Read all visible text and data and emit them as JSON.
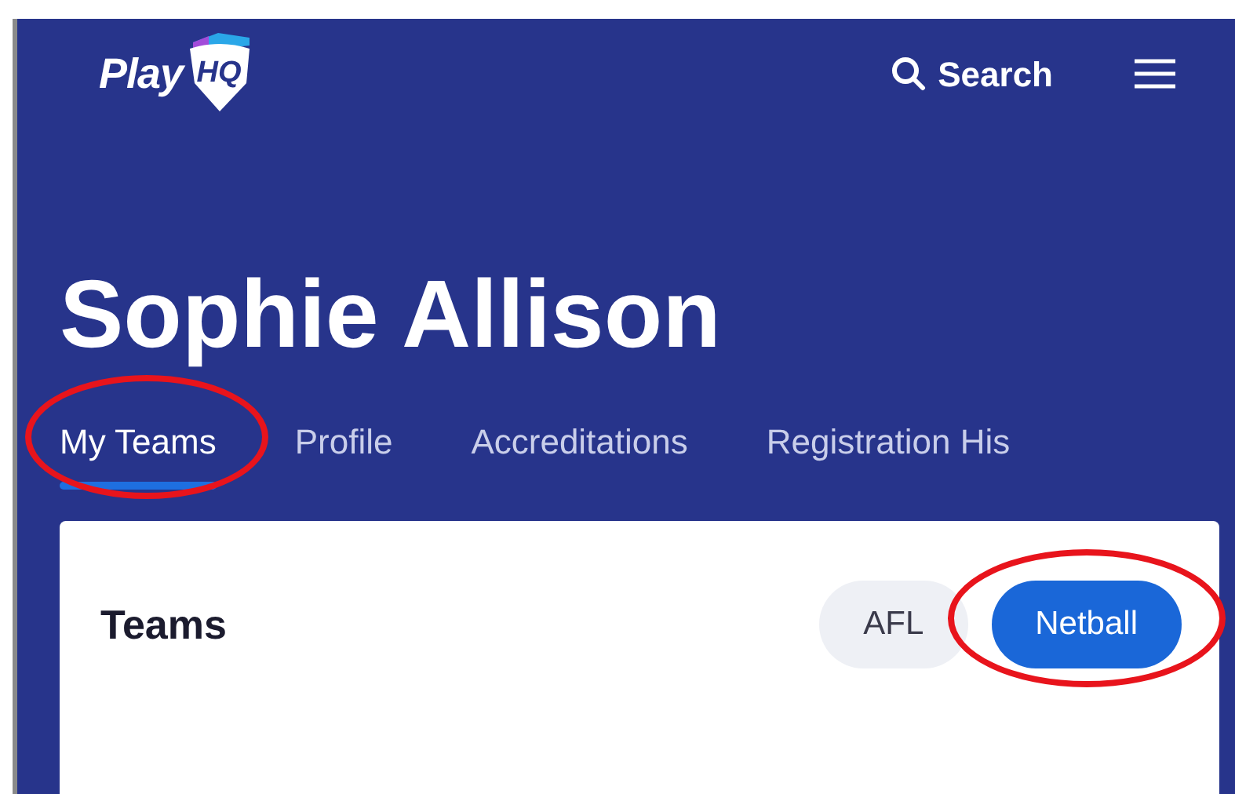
{
  "header": {
    "logo": {
      "text": "Play",
      "mark": "HQ"
    },
    "search": "Search"
  },
  "title": "Sophie Allison",
  "tabs": [
    {
      "label": "My Teams",
      "selected": true,
      "circled": true
    },
    {
      "label": "Profile",
      "selected": false,
      "circled": false
    },
    {
      "label": "Accreditations",
      "selected": false,
      "circled": false
    },
    {
      "label": "Registration His",
      "selected": false,
      "circled": false
    }
  ],
  "card": {
    "title": "Teams",
    "filters": [
      {
        "label": "AFL",
        "selected": false,
        "circled": false
      },
      {
        "label": "Netball",
        "selected": true,
        "circled": true
      }
    ]
  }
}
